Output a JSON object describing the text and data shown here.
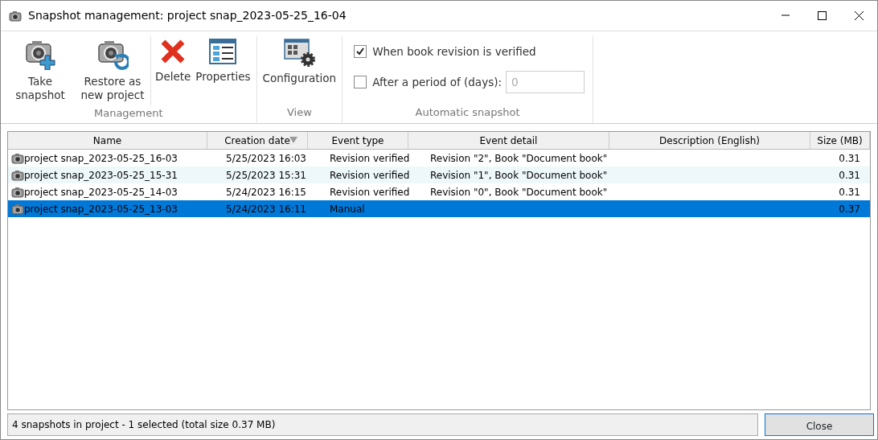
{
  "window": {
    "title": "Snapshot management: project snap_2023-05-25_16-04"
  },
  "ribbon": {
    "groups": [
      {
        "label": "Management",
        "buttons": [
          {
            "kind": "take",
            "label": "Take snapshot"
          },
          {
            "kind": "restore",
            "label": "Restore as new project"
          },
          {
            "kind": "delete",
            "label": "Delete"
          },
          {
            "kind": "properties",
            "label": "Properties"
          }
        ]
      },
      {
        "label": "View",
        "buttons": [
          {
            "kind": "configuration",
            "label": "Configuration"
          }
        ]
      },
      {
        "label": "Automatic snapshot",
        "options": [
          {
            "label": "When book revision is verified",
            "checked": true
          },
          {
            "label": "After a period of (days):",
            "checked": false,
            "value": "0",
            "disabled": true
          }
        ]
      }
    ]
  },
  "table": {
    "columns": [
      {
        "label": "Name",
        "sorted": false
      },
      {
        "label": "Creation date",
        "sorted": true
      },
      {
        "label": "Event type",
        "sorted": false
      },
      {
        "label": "Event detail",
        "sorted": false
      },
      {
        "label": "Description (English)",
        "sorted": false
      },
      {
        "label": "Size (MB)",
        "sorted": false
      }
    ],
    "rows": [
      {
        "selected": false,
        "cells": [
          "project snap_2023-05-25_16-03",
          "5/25/2023 16:03",
          "Revision verified",
          "Revision \"2\", Book \"Document book\"",
          "",
          "0.31"
        ]
      },
      {
        "selected": false,
        "cells": [
          "project snap_2023-05-25_15-31",
          "5/25/2023 15:31",
          "Revision verified",
          "Revision \"1\", Book \"Document book\"",
          "",
          "0.31"
        ]
      },
      {
        "selected": false,
        "cells": [
          "project snap_2023-05-25_14-03",
          "5/24/2023 16:15",
          "Revision verified",
          "Revision \"0\", Book \"Document book\"",
          "",
          "0.31"
        ]
      },
      {
        "selected": true,
        "cells": [
          "project snap_2023-05-25_13-03",
          "5/24/2023 16:11",
          "Manual",
          "",
          "",
          "0.37"
        ]
      }
    ]
  },
  "status_bar": {
    "text": "4 snapshots in project - 1 selected (total size 0.37 MB)"
  },
  "buttons": [
    {
      "label": "Close"
    }
  ]
}
